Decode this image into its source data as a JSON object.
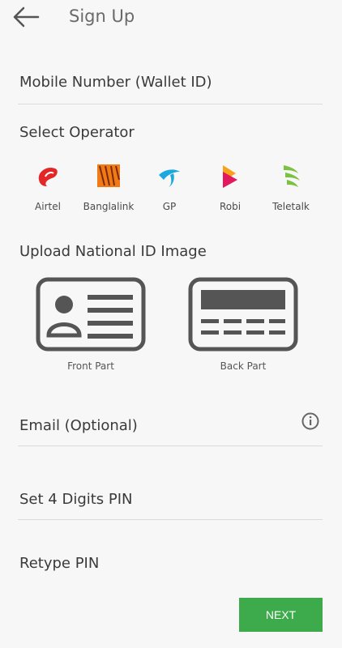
{
  "header": {
    "title": "Sign Up"
  },
  "form": {
    "mobile_label": "Mobile Number (Wallet ID)",
    "select_operator_title": "Select Operator",
    "operators": [
      {
        "name": "Airtel",
        "color": "#e32626"
      },
      {
        "name": "Banglalink",
        "color": "#f07b16"
      },
      {
        "name": "GP",
        "color": "#1ba8e0"
      },
      {
        "name": "Robi",
        "color": "#e2195f"
      },
      {
        "name": "Teletalk",
        "color": "#7cc242"
      }
    ],
    "upload_title": "Upload National ID Image",
    "front_label": "Front Part",
    "back_label": "Back Part",
    "email_label": "Email (Optional)",
    "pin_label": "Set 4 Digits PIN",
    "retype_label": "Retype PIN"
  },
  "actions": {
    "next_label": "NEXT",
    "accent": "#3daa4b"
  }
}
